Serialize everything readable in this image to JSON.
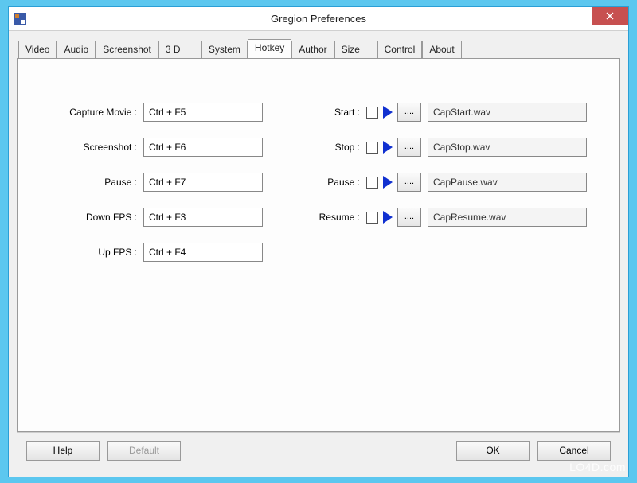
{
  "window": {
    "title": "Gregion Preferences"
  },
  "tabs": [
    {
      "label": "Video"
    },
    {
      "label": "Audio"
    },
    {
      "label": "Screenshot"
    },
    {
      "label": "3 D"
    },
    {
      "label": "System"
    },
    {
      "label": "Hotkey"
    },
    {
      "label": "Author"
    },
    {
      "label": "Size"
    },
    {
      "label": "Control"
    },
    {
      "label": "About"
    }
  ],
  "hotkeys": {
    "capture_movie": {
      "label": "Capture Movie :",
      "value": "Ctrl + F5"
    },
    "screenshot": {
      "label": "Screenshot :",
      "value": "Ctrl + F6"
    },
    "pause": {
      "label": "Pause :",
      "value": "Ctrl + F7"
    },
    "down_fps": {
      "label": "Down FPS :",
      "value": "Ctrl + F3"
    },
    "up_fps": {
      "label": "Up FPS :",
      "value": "Ctrl + F4"
    }
  },
  "sounds": {
    "start": {
      "label": "Start :",
      "browse": "....",
      "file": "CapStart.wav"
    },
    "stop": {
      "label": "Stop :",
      "browse": "....",
      "file": "CapStop.wav"
    },
    "pause": {
      "label": "Pause :",
      "browse": "....",
      "file": "CapPause.wav"
    },
    "resume": {
      "label": "Resume :",
      "browse": "....",
      "file": "CapResume.wav"
    }
  },
  "buttons": {
    "help": "Help",
    "default": "Default",
    "ok": "OK",
    "cancel": "Cancel"
  },
  "watermark": "LO4D.com"
}
